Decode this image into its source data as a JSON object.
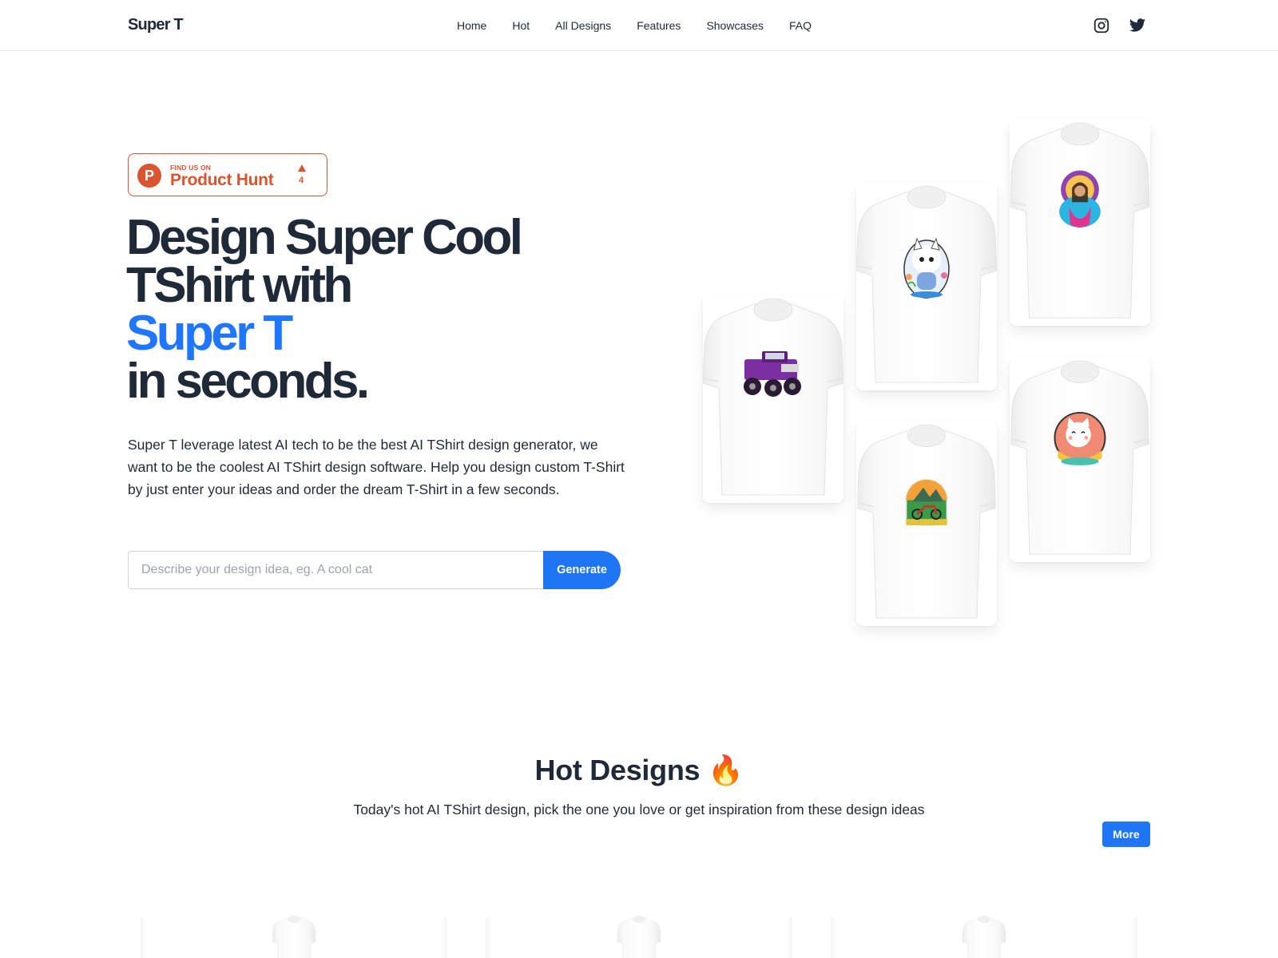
{
  "header": {
    "logo": "Super T",
    "nav": [
      {
        "label": "Home"
      },
      {
        "label": "Hot"
      },
      {
        "label": "All Designs"
      },
      {
        "label": "Features"
      },
      {
        "label": "Showcases"
      },
      {
        "label": "FAQ"
      }
    ],
    "social": [
      {
        "icon": "instagram-icon"
      },
      {
        "icon": "twitter-icon"
      }
    ]
  },
  "product_hunt": {
    "logo_letter": "P",
    "find_text": "FIND US ON",
    "name": "Product Hunt",
    "upvotes": "4",
    "color": "#da552f"
  },
  "hero": {
    "title_line1": "Design Super Cool",
    "title_line2": "TShirt with",
    "title_accent": "Super T",
    "title_line4": "in seconds.",
    "accent_color": "#2176ff",
    "description": "Super T leverage latest AI tech to be the best AI TShirt design generator, we want to be the coolest AI TShirt design software. Help you design custom T-Shirt by just enter your ideas and order the dream T-Shirt in a few seconds.",
    "search_placeholder": "Describe your design idea, eg. A cool cat",
    "search_value": "",
    "generate_label": "Generate"
  },
  "showcase": [
    {
      "design": "purple monster truck"
    },
    {
      "design": "white cat with flowers"
    },
    {
      "design": "girl with halo"
    },
    {
      "design": "motorcycle mountain badge"
    },
    {
      "design": "happy cat on cushion"
    }
  ],
  "hot_designs": {
    "title": "Hot Designs",
    "emoji": "🔥",
    "subtitle": "Today's hot AI TShirt design, pick the one you love or get inspiration from these design ideas",
    "more_label": "More",
    "cards": [
      {
        "design": "blank t-shirt"
      },
      {
        "design": "blank t-shirt"
      },
      {
        "design": "blank t-shirt"
      }
    ]
  },
  "colors": {
    "primary": "#1f76f5",
    "text": "#1f2937",
    "border": "#e5e7eb"
  }
}
